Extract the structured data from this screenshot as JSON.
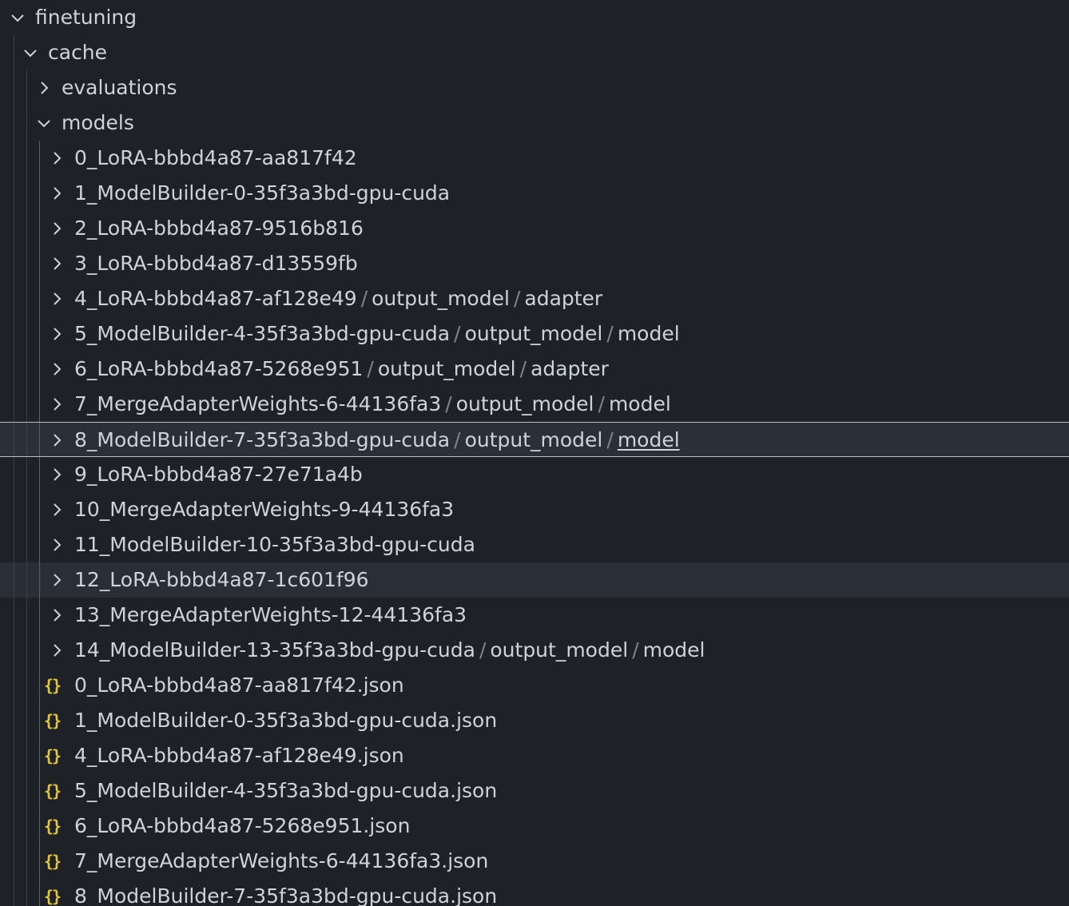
{
  "tree": {
    "root": {
      "label": "finetuning"
    },
    "cache": {
      "label": "cache"
    },
    "evaluations": {
      "label": "evaluations"
    },
    "models": {
      "label": "models"
    },
    "model_folders": [
      {
        "label": "0_LoRA-bbbd4a87-aa817f42",
        "compact": []
      },
      {
        "label": "1_ModelBuilder-0-35f3a3bd-gpu-cuda",
        "compact": []
      },
      {
        "label": "2_LoRA-bbbd4a87-9516b816",
        "compact": []
      },
      {
        "label": "3_LoRA-bbbd4a87-d13559fb",
        "compact": []
      },
      {
        "label": "4_LoRA-bbbd4a87-af128e49",
        "compact": [
          "output_model",
          "adapter"
        ]
      },
      {
        "label": "5_ModelBuilder-4-35f3a3bd-gpu-cuda",
        "compact": [
          "output_model",
          "model"
        ]
      },
      {
        "label": "6_LoRA-bbbd4a87-5268e951",
        "compact": [
          "output_model",
          "adapter"
        ]
      },
      {
        "label": "7_MergeAdapterWeights-6-44136fa3",
        "compact": [
          "output_model",
          "model"
        ]
      },
      {
        "label": "8_ModelBuilder-7-35f3a3bd-gpu-cuda",
        "compact": [
          "output_model",
          "model"
        ]
      },
      {
        "label": "9_LoRA-bbbd4a87-27e71a4b",
        "compact": []
      },
      {
        "label": "10_MergeAdapterWeights-9-44136fa3",
        "compact": []
      },
      {
        "label": "11_ModelBuilder-10-35f3a3bd-gpu-cuda",
        "compact": []
      },
      {
        "label": "12_LoRA-bbbd4a87-1c601f96",
        "compact": []
      },
      {
        "label": "13_MergeAdapterWeights-12-44136fa3",
        "compact": []
      },
      {
        "label": "14_ModelBuilder-13-35f3a3bd-gpu-cuda",
        "compact": [
          "output_model",
          "model"
        ]
      }
    ],
    "separator": "/",
    "json_icon": "{}",
    "json_files": [
      {
        "label": "0_LoRA-bbbd4a87-aa817f42.json"
      },
      {
        "label": "1_ModelBuilder-0-35f3a3bd-gpu-cuda.json"
      },
      {
        "label": "4_LoRA-bbbd4a87-af128e49.json"
      },
      {
        "label": "5_ModelBuilder-4-35f3a3bd-gpu-cuda.json"
      },
      {
        "label": "6_LoRA-bbbd4a87-5268e951.json"
      },
      {
        "label": "7_MergeAdapterWeights-6-44136fa3.json"
      },
      {
        "label": "8_ModelBuilder-7-35f3a3bd-gpu-cuda.json"
      }
    ]
  },
  "state": {
    "focused_folder": "8_ModelBuilder-7-35f3a3bd-gpu-cuda",
    "hovered_folder": "12_LoRA-bbbd4a87-1c601f96"
  },
  "colors": {
    "background": "#1e2227",
    "text": "#cdd3da",
    "json_icon": "#e2c43e",
    "focus_border": "#b7bec6"
  }
}
